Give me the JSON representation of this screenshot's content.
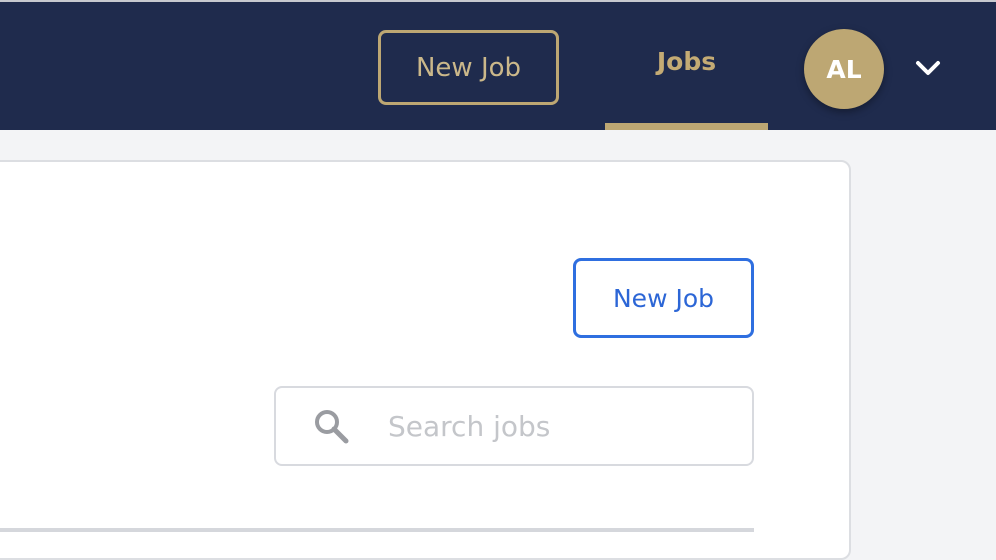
{
  "header": {
    "new_job_label": "New Job",
    "jobs_tab_label": "Jobs",
    "avatar_initials": "AL",
    "dropdown_icon": "chevron-down-icon"
  },
  "main": {
    "new_job_label": "New Job",
    "search": {
      "placeholder": "Search jobs",
      "value": "",
      "icon": "search-icon"
    }
  },
  "colors": {
    "navbar": "#1f2b4d",
    "gold_accent": "#bda773",
    "primary_blue": "#2f6fe0",
    "page_background": "#f3f4f6"
  }
}
